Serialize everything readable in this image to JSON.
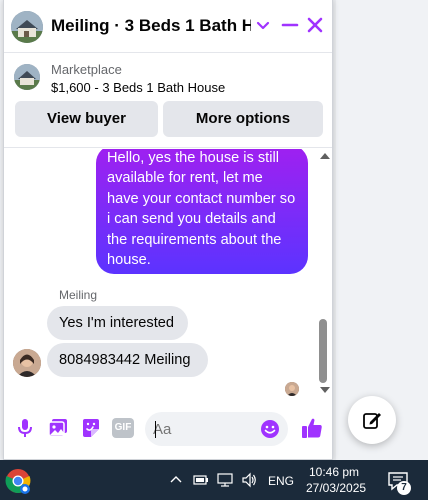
{
  "header": {
    "title": "Meiling · 3 Beds 1 Bath Ho...",
    "accent_color": "#a033ff"
  },
  "listing": {
    "source": "Marketplace",
    "title": "$1,600 - 3 Beds 1 Bath House",
    "view_buyer_label": "View buyer",
    "more_options_label": "More options"
  },
  "messages": {
    "outgoing_text": "Hello, yes the house is still available for rent, let me have your contact number so i can send you details and the requirements about the house.",
    "sender_name": "Meiling",
    "incoming": [
      {
        "text": "Yes I'm interested"
      },
      {
        "text": "8084983442 Meiling"
      }
    ]
  },
  "composer": {
    "placeholder": "Aa",
    "gif_label": "GIF"
  },
  "taskbar": {
    "language": "ENG",
    "time": "10:46 pm",
    "date": "27/03/2025",
    "notification_count": "7"
  }
}
